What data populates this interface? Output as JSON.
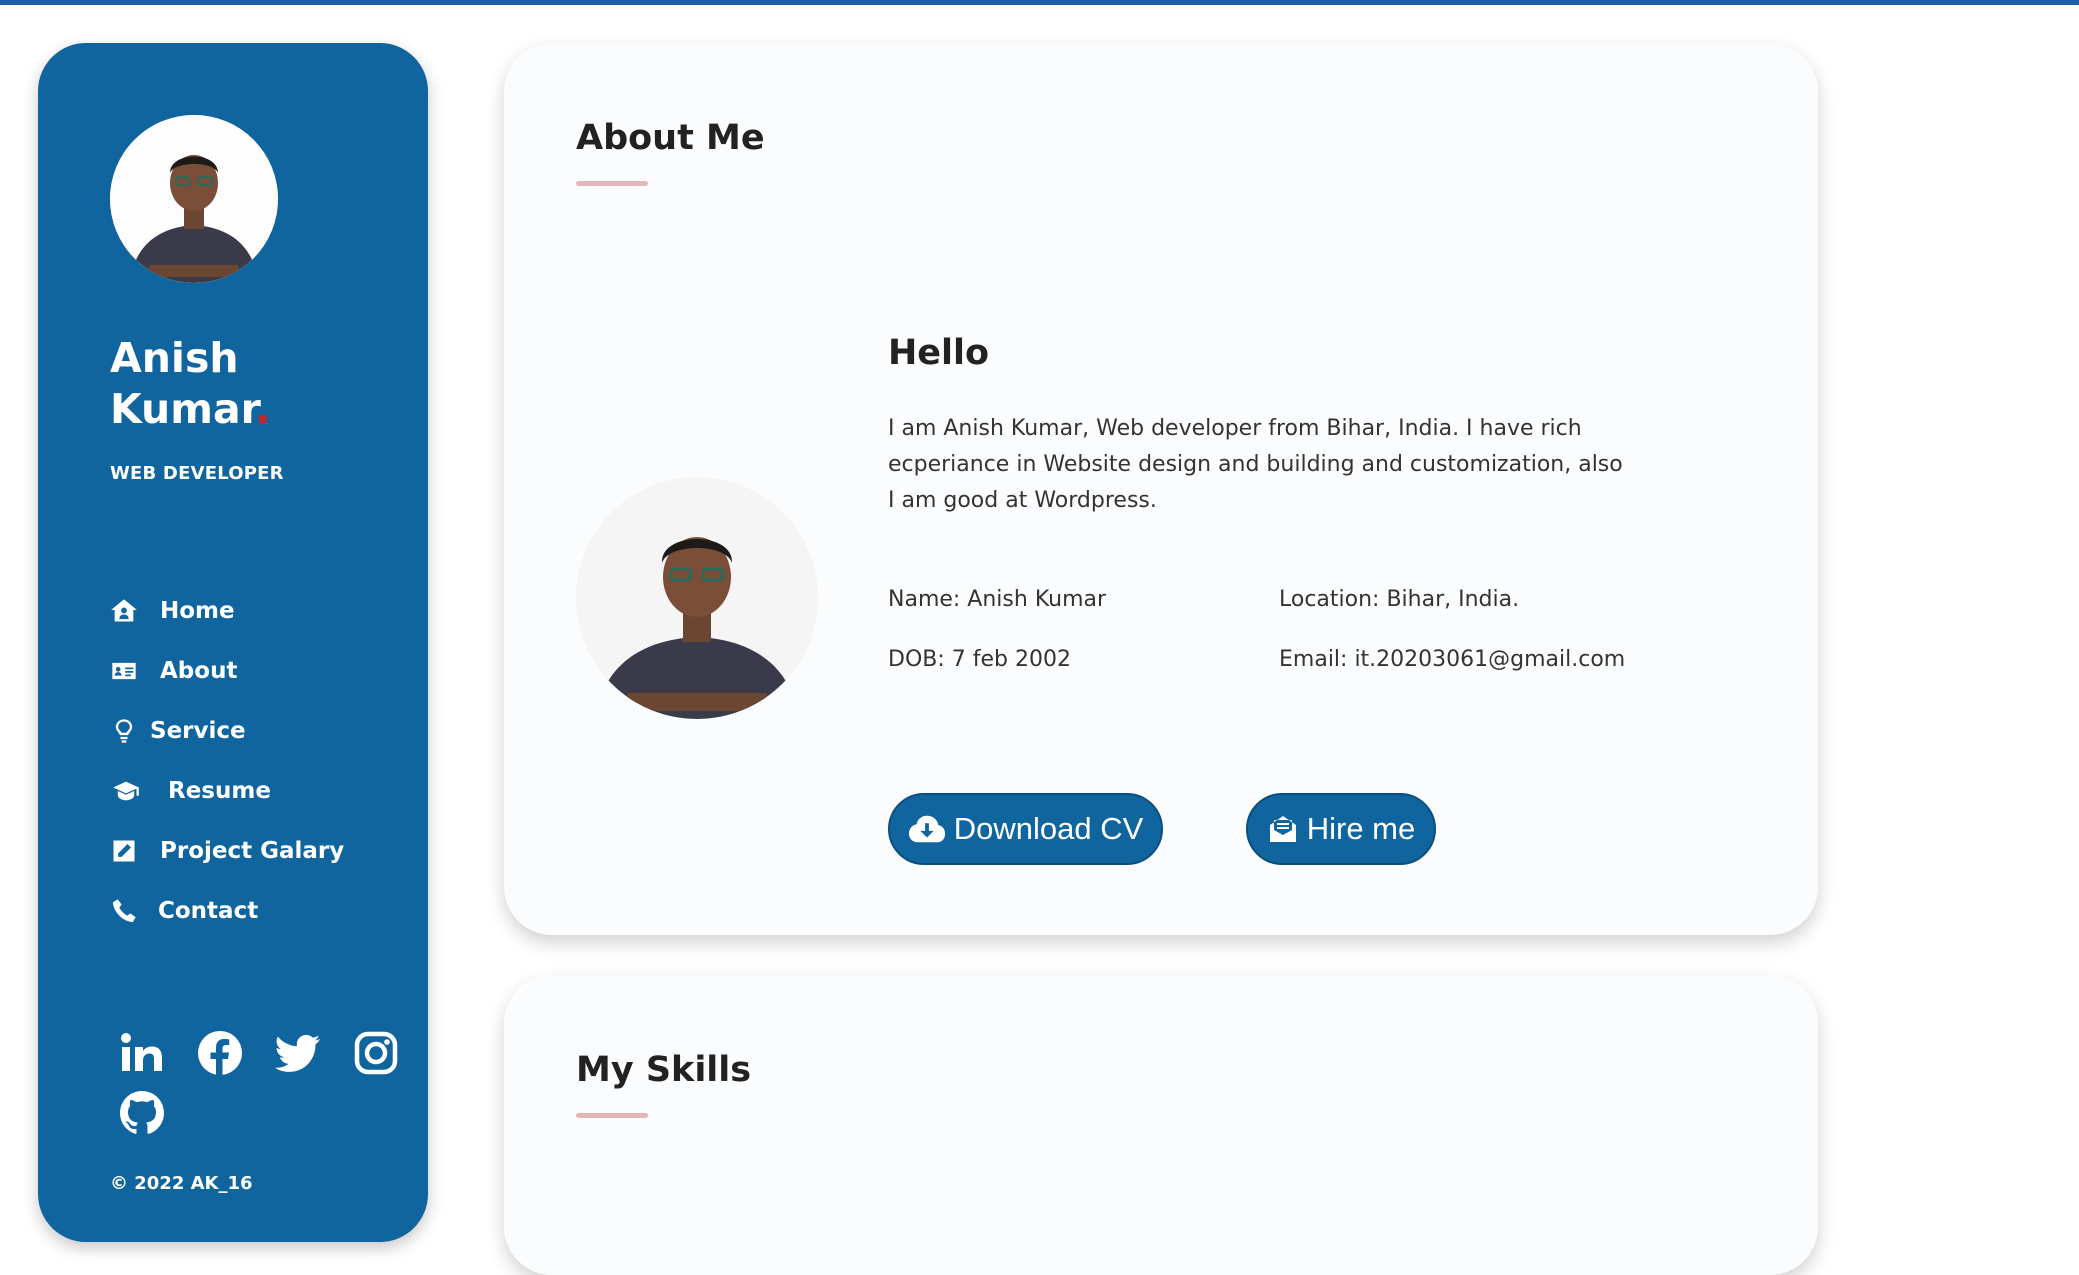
{
  "sidebar": {
    "name_line1": "Anish",
    "name_line2": "Kumar",
    "name_dot": ".",
    "role": "WEB DEVELOPER",
    "nav": [
      {
        "label": "Home",
        "icon": "home-icon"
      },
      {
        "label": "About",
        "icon": "id-card-icon"
      },
      {
        "label": "Service",
        "icon": "lightbulb-icon"
      },
      {
        "label": "Resume",
        "icon": "graduation-cap-icon"
      },
      {
        "label": "Project Galary",
        "icon": "edit-icon"
      },
      {
        "label": "Contact",
        "icon": "phone-icon"
      }
    ],
    "social": [
      "linkedin-icon",
      "facebook-icon",
      "twitter-icon",
      "instagram-icon",
      "github-icon"
    ],
    "copyright": "© 2022 AK_16"
  },
  "about": {
    "title": "About Me",
    "hello": "Hello",
    "bio": "I am Anish Kumar, Web developer from Bihar, India. I have rich ecperiance in Website design and building and customization, also I am good at Wordpress.",
    "name": "Name: Anish Kumar",
    "dob": "DOB: 7 feb 2002",
    "location": "Location: Bihar, India.",
    "email": "Email: it.20203061@gmail.com",
    "download_label": "Download CV",
    "hire_label": "Hire me"
  },
  "skills": {
    "title": "My Skills"
  },
  "colors": {
    "sidebar_bg": "#10659f",
    "accent_dot": "#c62828",
    "underline": "#e3b7b9",
    "top_line": "#1b5fa8"
  }
}
